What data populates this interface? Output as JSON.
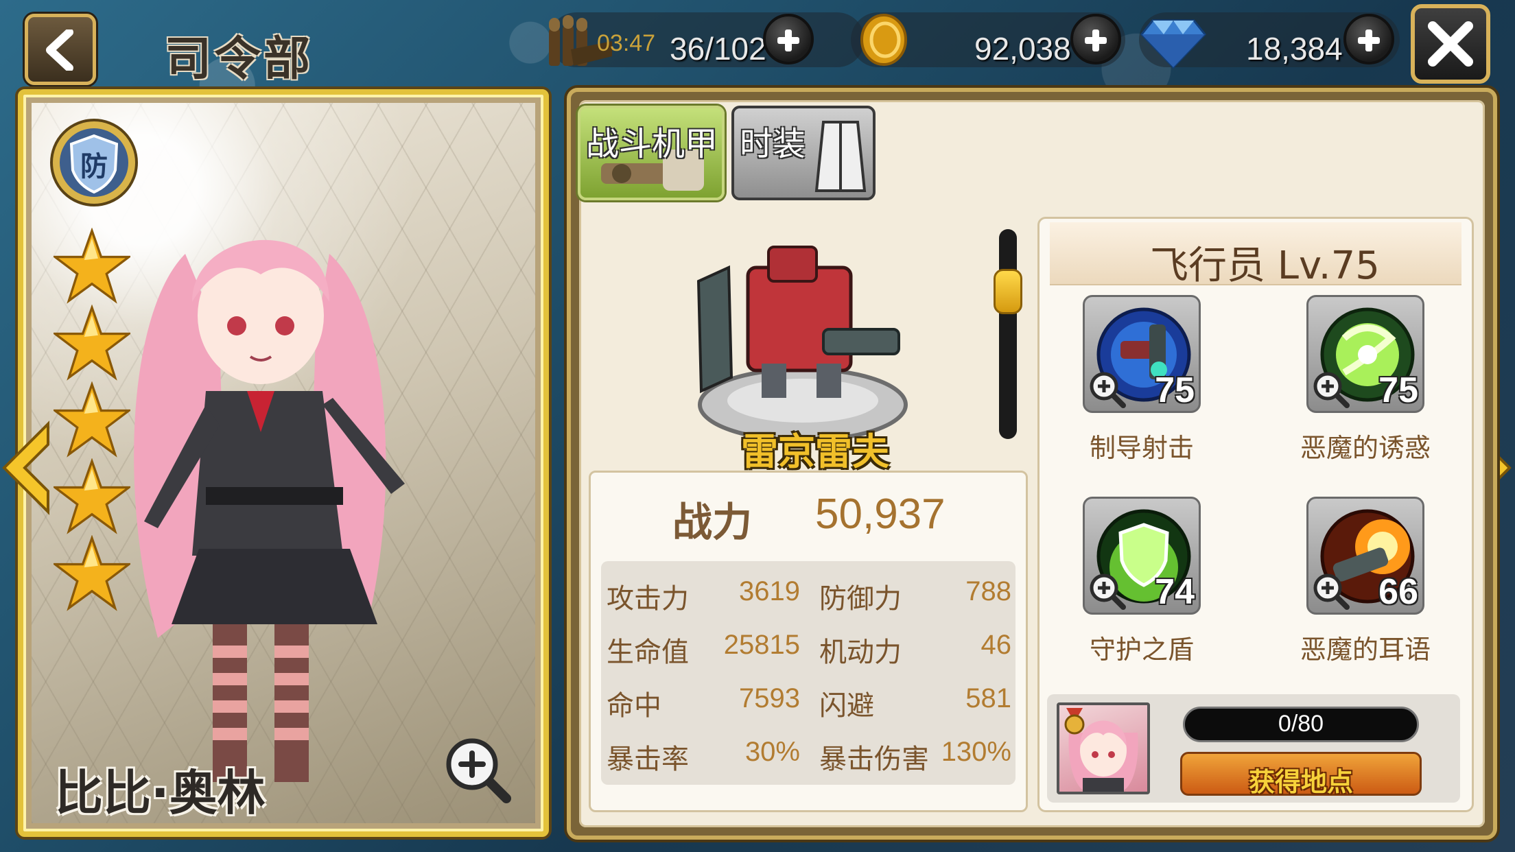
{
  "header": {
    "title": "司令部",
    "energy_timer": "03:47",
    "energy": "36/102",
    "gold": "92,038",
    "diamonds": "18,384"
  },
  "icons": {
    "back": "back-arrow-icon",
    "close": "close-icon",
    "energy": "ammo-icon",
    "gold": "gold-coin-icon",
    "diamond": "diamond-icon",
    "plus": "plus-icon",
    "role": "defense-shield-icon",
    "zoom": "zoom-icon"
  },
  "character": {
    "name": "比比·奥林",
    "role_label": "防",
    "stars": 5
  },
  "tabs": [
    {
      "label": "战斗机甲"
    },
    {
      "label": "时装"
    }
  ],
  "mech": {
    "name": "雷京雷夫"
  },
  "stats": {
    "power_label": "战力",
    "power_value": "50,937",
    "rows": [
      {
        "left_name": "攻击力",
        "left_value": "3619",
        "right_name": "防御力",
        "right_value": "788"
      },
      {
        "left_name": "生命值",
        "left_value": "25815",
        "right_name": "机动力",
        "right_value": "46"
      },
      {
        "left_name": "命中",
        "left_value": "7593",
        "right_name": "闪避",
        "right_value": "581"
      },
      {
        "left_name": "暴击率",
        "left_value": "30%",
        "right_name": "暴击伤害",
        "right_value": "130%"
      }
    ]
  },
  "pilot": {
    "title": "飞行员 Lv.75",
    "skills": [
      {
        "name": "制导射击",
        "level": "75"
      },
      {
        "name": "恶魔的诱惑",
        "level": "75"
      },
      {
        "name": "守护之盾",
        "level": "74"
      },
      {
        "name": "恶魔的耳语",
        "level": "66"
      }
    ],
    "fragments": "0/80",
    "obtain_label": "获得地点"
  },
  "colors": {
    "gold_border": "#e3c23b",
    "panel_bg": "#f3ecdc",
    "stat_value": "#b27c31",
    "obtain_button": "#e07a20"
  }
}
